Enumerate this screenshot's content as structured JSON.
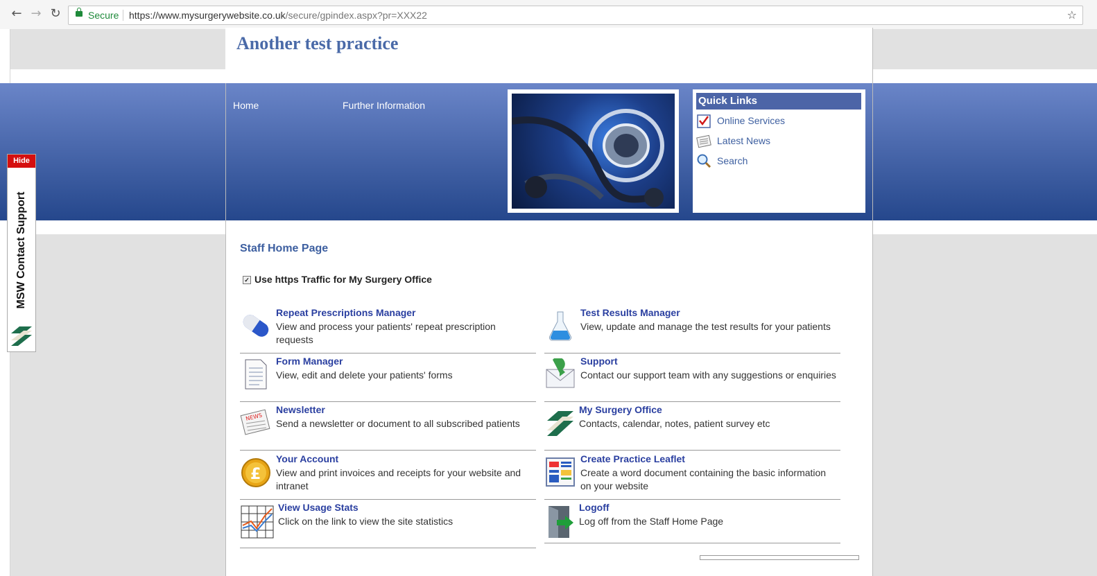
{
  "browser": {
    "secure_label": "Secure",
    "url_main": "https://www.mysurgerywebsite.co.uk",
    "url_path": "/secure/gpindex.aspx?pr=XXX22"
  },
  "practice": {
    "title": "Another test practice"
  },
  "nav": {
    "items": [
      {
        "label": "Home"
      },
      {
        "label": "Further Information"
      }
    ]
  },
  "quick_links": {
    "title": "Quick Links",
    "items": [
      {
        "label": "Online Services",
        "icon": "checklist-icon"
      },
      {
        "label": "Latest News",
        "icon": "newspaper-icon"
      },
      {
        "label": "Search",
        "icon": "magnifier-icon"
      }
    ]
  },
  "staff": {
    "title": "Staff Home Page",
    "https_label": "Use https Traffic for My Surgery Office",
    "https_checked": true
  },
  "menu": [
    {
      "title": "Repeat Prescriptions Manager",
      "desc": "View and process your patients' repeat prescription requests",
      "icon": "capsule-icon"
    },
    {
      "title": "Test Results Manager",
      "desc": "View, update and manage the test results for your patients",
      "icon": "flask-icon"
    },
    {
      "title": "Form Manager",
      "desc": "View, edit and delete your patients' forms",
      "icon": "document-icon"
    },
    {
      "title": "Support",
      "desc": "Contact our support team with any suggestions or enquiries",
      "icon": "envelope-icon"
    },
    {
      "title": "Newsletter",
      "desc": "Send a newsletter or document to all subscribed patients",
      "icon": "newspaper-icon"
    },
    {
      "title": "My Surgery Office",
      "desc": "Contacts, calendar, notes, patient survey etc",
      "icon": "msw-logo-icon"
    },
    {
      "title": "Your Account",
      "desc": "View and print invoices and receipts for your website and intranet",
      "icon": "pound-coin-icon"
    },
    {
      "title": "Create Practice Leaflet",
      "desc": "Create a word document containing the basic information on your website",
      "icon": "leaflet-icon"
    },
    {
      "title": "View Usage Stats",
      "desc": "Click on the link to view the site statistics",
      "icon": "chart-icon"
    },
    {
      "title": "Logoff",
      "desc": "Log off from the Staff Home Page",
      "icon": "door-exit-icon"
    }
  ],
  "support_tab": {
    "hide_label": "Hide",
    "label": "MSW Contact Support"
  },
  "colors": {
    "banner_top": "#6a85c8",
    "banner_bottom": "#25478c",
    "link": "#2a3fa0",
    "accent": "#4c65a7",
    "hide_red": "#d50f0f"
  }
}
